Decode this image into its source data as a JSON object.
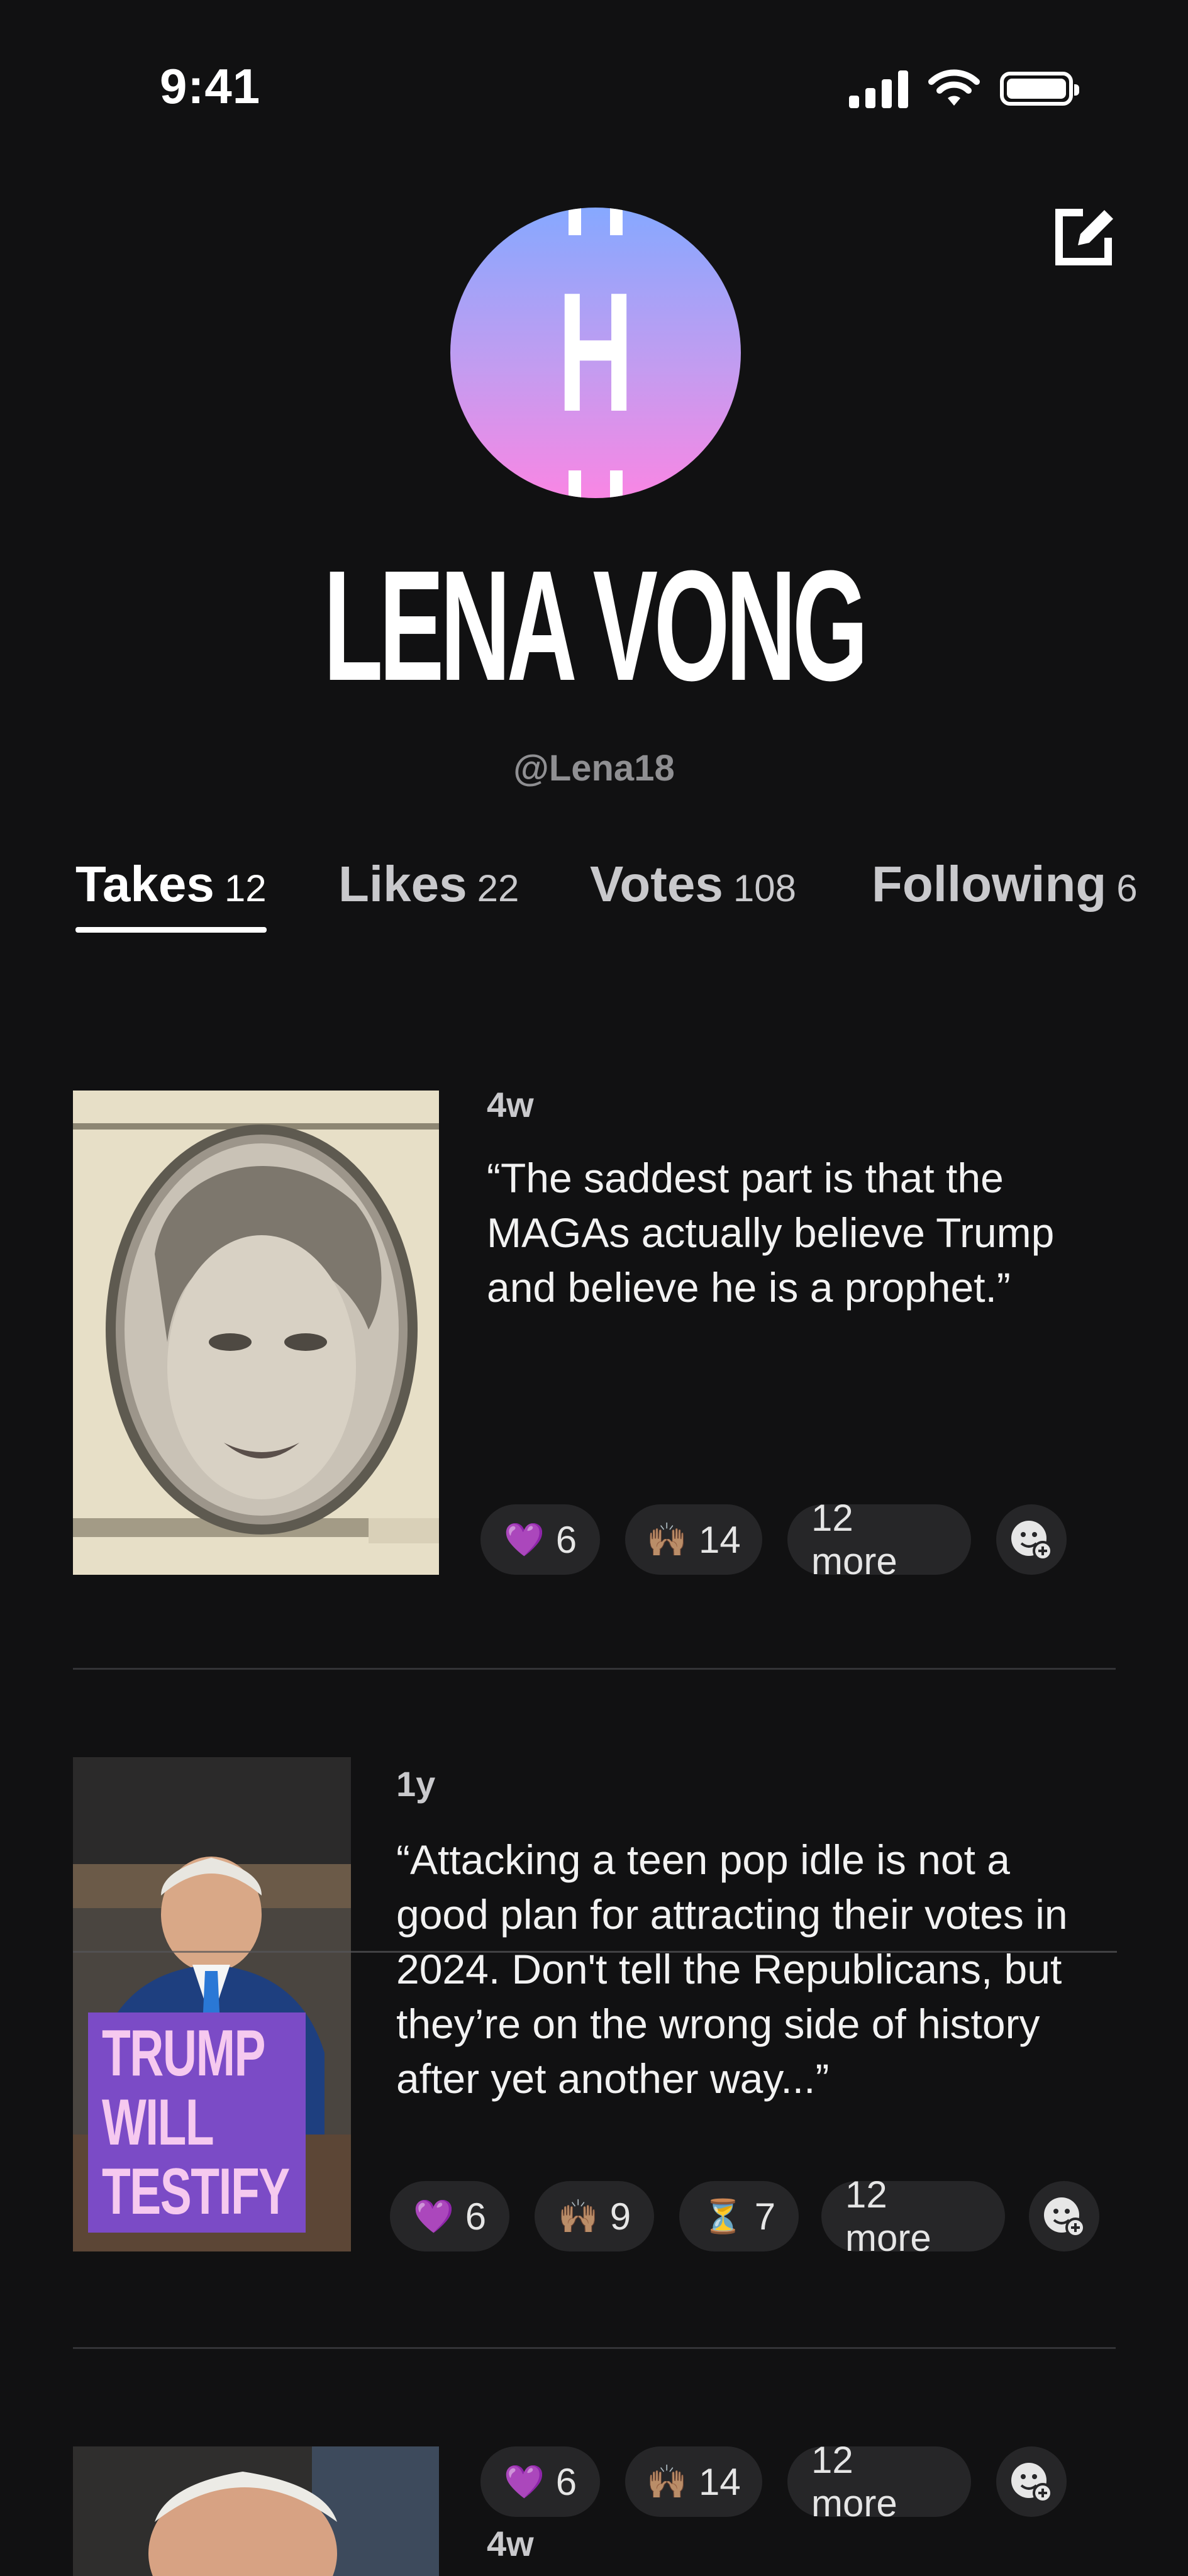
{
  "status_bar": {
    "time": "9:41",
    "icons": [
      "signal-icon",
      "wifi-icon",
      "battery-icon"
    ]
  },
  "profile": {
    "avatar_letter": "H",
    "name": "LENA VONG",
    "handle": "@Lena18",
    "edit_icon": "edit-icon"
  },
  "tabs": [
    {
      "label": "Takes",
      "count": "12",
      "active": true
    },
    {
      "label": "Likes",
      "count": "22",
      "active": false
    },
    {
      "label": "Votes",
      "count": "108",
      "active": false
    },
    {
      "label": "Following",
      "count": "6",
      "active": false
    }
  ],
  "posts": [
    {
      "age": "4w",
      "text": "“The saddest part is that the MAGAs actually believe Trump and believe he is a prophet.”",
      "reactions": [
        {
          "emoji": "💜",
          "count": "6"
        },
        {
          "emoji": "🙌🏽",
          "count": "14"
        }
      ],
      "more": "12 more"
    },
    {
      "age": "1y",
      "text": "“Attacking a teen pop idle is not a good plan for attracting their votes in 2024. Don't tell the Republicans, but they’re on the wrong side of history after yet another way...”",
      "thumb_caption": [
        "TRUMP",
        "WILL",
        "TESTIFY"
      ],
      "reactions": [
        {
          "emoji": "💜",
          "count": "6"
        },
        {
          "emoji": "🙌🏽",
          "count": "9"
        },
        {
          "emoji": "⏳",
          "count": "7"
        }
      ],
      "more": "12 more"
    },
    {
      "age": "4w",
      "reactions": [
        {
          "emoji": "💜",
          "count": "6"
        },
        {
          "emoji": "🙌🏽",
          "count": "14"
        }
      ],
      "more": "12 more"
    }
  ],
  "colors": {
    "background": "#111112",
    "chip": "#262628",
    "avatar_top": "#86a8ff",
    "avatar_bottom": "#f986e4",
    "caption_bg": "#7b4bc6",
    "caption_text": "#f6c9ef"
  }
}
